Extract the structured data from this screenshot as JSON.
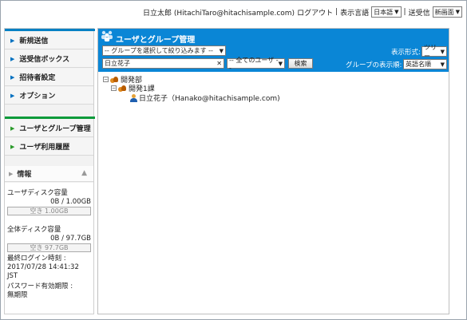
{
  "header": {
    "user_display": "日立太郎 (HitachiTaro@hitachisample.com)",
    "logout_label": "ログアウト",
    "separator": "|",
    "language_label": "表示言語",
    "language_value": "日本語",
    "send_label": "送受信",
    "send_value": "新画面"
  },
  "sidebar": {
    "nav_items": [
      {
        "label": "新規送信"
      },
      {
        "label": "送受信ボックス"
      },
      {
        "label": "招待者設定"
      },
      {
        "label": "オプション"
      },
      {
        "label": "ユーザとグループ管理"
      },
      {
        "label": "ユーザ利用履歴"
      }
    ],
    "info": {
      "title": "情報",
      "user_disk_label": "ユーザディスク容量",
      "user_disk_value": "0B / 1.00GB",
      "user_disk_free": "空き 1.00GB",
      "total_disk_label": "全体ディスク容量",
      "total_disk_value": "0B / 97.7GB",
      "total_disk_free": "空き 97.7GB",
      "last_login_label": "最終ログイン時刻 :",
      "last_login_value": "2017/07/28 14:41:32 JST",
      "password_label": "パスワード有効期限 :",
      "password_value": "無期限"
    }
  },
  "main": {
    "title": "ユーザとグループ管理",
    "group_filter": "-- グループを選択して絞り込みます --",
    "search_text": "日立花子",
    "clear_symbol": "✕",
    "user_filter": "-- 全てのユーザ --",
    "search_button": "検索",
    "display_format_label": "表示形式:",
    "display_format_value": "ツリー",
    "group_order_label": "グループの表示順:",
    "group_order_value": "英語名順",
    "tree": {
      "root": "開発部",
      "child": "開発1課",
      "user": "日立花子（Hanako@hitachisample.com)"
    }
  },
  "colors": {
    "accent_blue": "#0a86d6",
    "nav_rule_green": "#0a9a3a"
  }
}
